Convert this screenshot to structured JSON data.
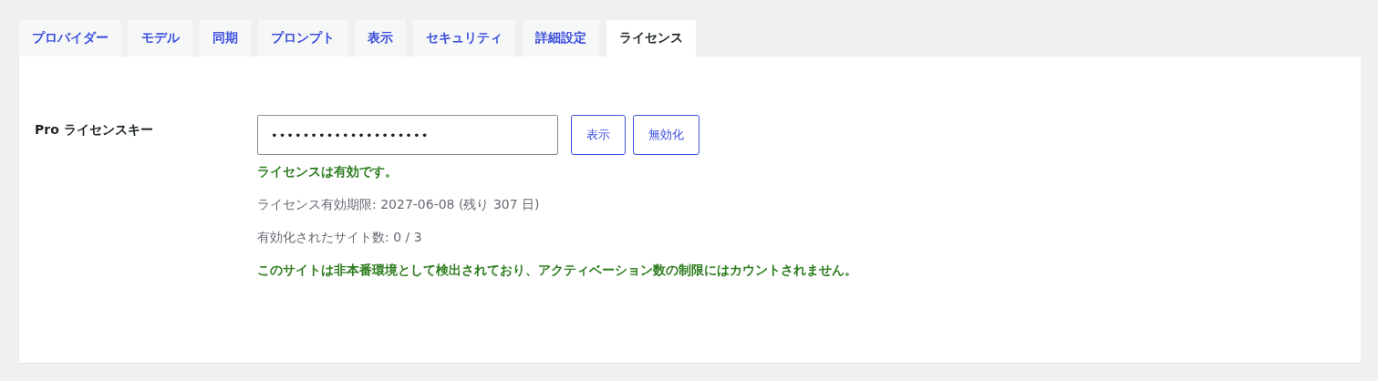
{
  "tabs": [
    {
      "label": "プロバイダー",
      "selected": false
    },
    {
      "label": "モデル",
      "selected": false
    },
    {
      "label": "同期",
      "selected": false
    },
    {
      "label": "プロンプト",
      "selected": false
    },
    {
      "label": "表示",
      "selected": false
    },
    {
      "label": "セキュリティ",
      "selected": false
    },
    {
      "label": "詳細設定",
      "selected": false
    },
    {
      "label": "ライセンス",
      "selected": true
    }
  ],
  "license": {
    "label": "Pro ライセンスキー",
    "key_field": {
      "value": "••••••••••••••••••••"
    },
    "buttons": [
      "表示",
      "無効化"
    ],
    "messages": [
      {
        "kind": "success",
        "text": "ライセンスは有効です。"
      },
      {
        "kind": "info",
        "text": "ライセンス有効期限: 2027-06-08 (残り 307 日)"
      },
      {
        "kind": "info",
        "text": "有効化されたサイト数: 0 / 3"
      },
      {
        "kind": "success",
        "text": "このサイトは非本番環境として検出されており、アクティベーション数の制限にはカウントされません。"
      }
    ]
  }
}
